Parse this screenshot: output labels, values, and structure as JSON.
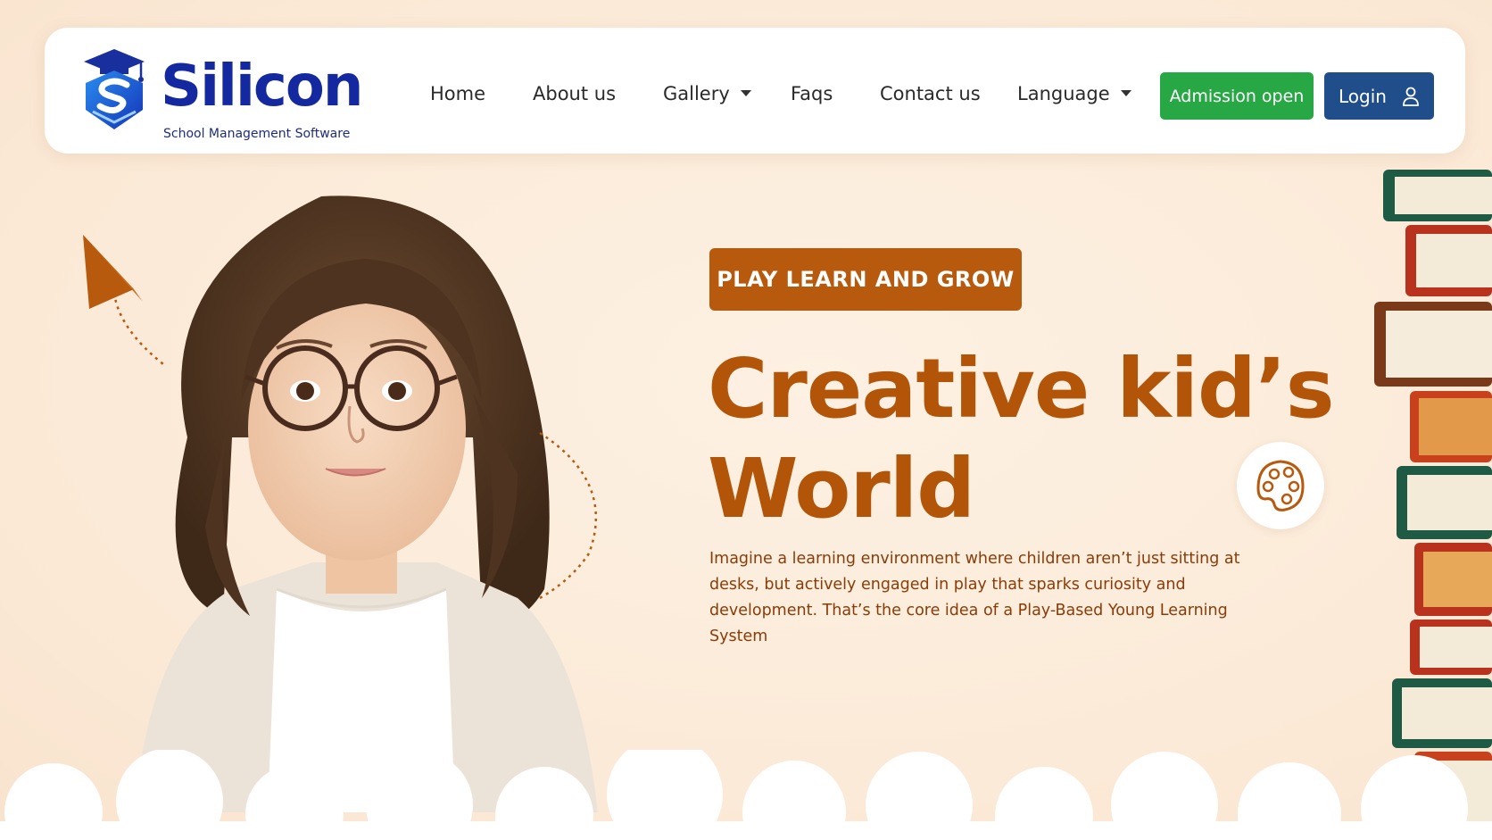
{
  "brand": {
    "title": "Silicon",
    "subtitle": "School Management Software",
    "icon": "graduation-cap-shield-logo"
  },
  "nav": {
    "items": [
      {
        "label": "Home",
        "dropdown": false
      },
      {
        "label": "About us",
        "dropdown": false
      },
      {
        "label": "Gallery",
        "dropdown": true
      },
      {
        "label": "Faqs",
        "dropdown": false
      },
      {
        "label": "Contact us",
        "dropdown": false
      },
      {
        "label": "Language",
        "dropdown": true
      }
    ],
    "admission_label": "Admission open",
    "login_label": "Login",
    "login_icon": "user-icon"
  },
  "hero": {
    "badge": "PLAY LEARN AND GROW",
    "headline_line1": "Creative kid’s",
    "headline_line2": "World",
    "description": "Imagine a learning environment where children aren’t just sitting at desks, but actively engaged in play that sparks curiosity and development. That’s the core idea of a Play-Based Young Learning System",
    "palette_icon": "paint-palette-icon"
  },
  "colors": {
    "background": "#fcecdc",
    "accent_orange": "#b85a0e",
    "brand_blue": "#1428a0",
    "admission_green": "#28a745",
    "login_blue": "#1f4e8a"
  }
}
